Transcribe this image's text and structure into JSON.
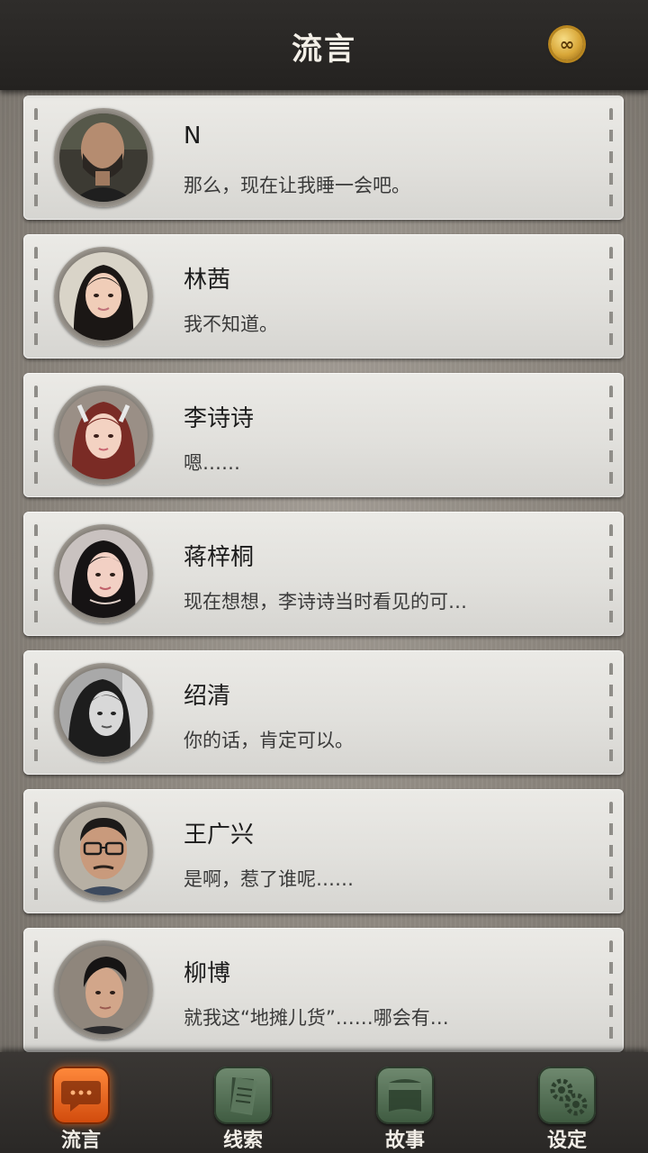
{
  "header": {
    "title": "流言",
    "coin_icon": "infinity-coin-icon",
    "coin_symbol": "∞"
  },
  "contacts": [
    {
      "name": "N",
      "message": "那么，现在让我睡一会吧。"
    },
    {
      "name": "林茜",
      "message": "我不知道。"
    },
    {
      "name": "李诗诗",
      "message": "嗯……"
    },
    {
      "name": "蒋梓桐",
      "message": "现在想想，李诗诗当时看见的可…"
    },
    {
      "name": "绍清",
      "message": "你的话，肯定可以。"
    },
    {
      "name": "王广兴",
      "message": "是啊，惹了谁呢……"
    },
    {
      "name": "柳博",
      "message": "就我这“地摊儿货”……哪会有…"
    }
  ],
  "nav": [
    {
      "label": "流言",
      "icon": "chat-bubble-icon",
      "active": true
    },
    {
      "label": "线索",
      "icon": "papers-icon",
      "active": false
    },
    {
      "label": "故事",
      "icon": "book-icon",
      "active": false
    },
    {
      "label": "设定",
      "icon": "gears-icon",
      "active": false
    }
  ],
  "colors": {
    "active_nav": "#e0621c",
    "inactive_nav": "#4f6b50",
    "header_bg": "#2a2826"
  }
}
